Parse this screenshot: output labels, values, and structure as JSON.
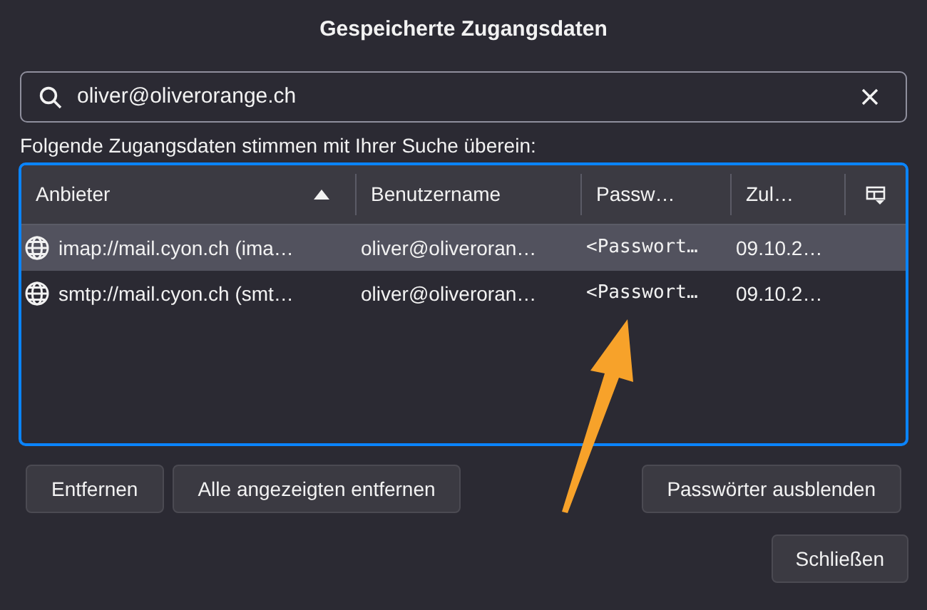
{
  "window": {
    "title": "Gespeicherte Zugangsdaten"
  },
  "search": {
    "value": "oliver@oliverorange.ch"
  },
  "match_label": "Folgende Zugangsdaten stimmen mit Ihrer Suche überein:",
  "table": {
    "columns": [
      {
        "label": "Anbieter",
        "sorted": true
      },
      {
        "label": "Benutzername",
        "sorted": false
      },
      {
        "label": "Passw…",
        "sorted": false
      },
      {
        "label": "Zul…",
        "sorted": false
      }
    ],
    "rows": [
      {
        "selected": true,
        "cells": [
          "imap://mail.cyon.ch (ima…",
          "oliver@oliveroran…",
          "<Passwort…",
          "09.10.2…"
        ]
      },
      {
        "selected": false,
        "cells": [
          "smtp://mail.cyon.ch (smt…",
          "oliver@oliveroran…",
          "<Passwort…",
          "09.10.2…"
        ]
      }
    ]
  },
  "left_buttons": [
    "Entfernen",
    "Alle angezeigten entfernen"
  ],
  "toggle_button": "Passwörter ausblenden",
  "close_button": "Schließen"
}
